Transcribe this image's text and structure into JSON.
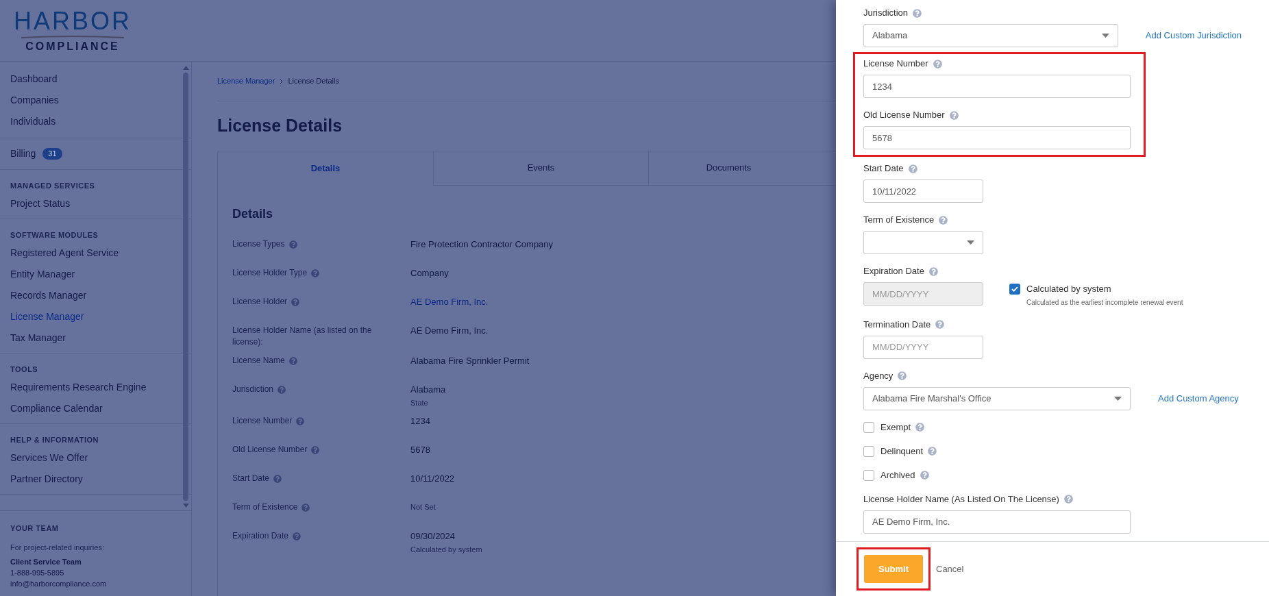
{
  "logo": {
    "name": "HARBOR",
    "tagline": "COMPLIANCE"
  },
  "sidebar": {
    "sections": [
      {
        "items": [
          {
            "label": "Dashboard",
            "selected": false
          },
          {
            "label": "Companies",
            "selected": false
          },
          {
            "label": "Individuals",
            "selected": false
          }
        ]
      },
      {
        "items": [
          {
            "label": "Billing",
            "selected": false,
            "badge": "31"
          }
        ]
      },
      {
        "heading": "MANAGED SERVICES",
        "items": [
          {
            "label": "Project Status",
            "selected": false
          }
        ]
      },
      {
        "heading": "SOFTWARE MODULES",
        "items": [
          {
            "label": "Registered Agent Service",
            "selected": false
          },
          {
            "label": "Entity Manager",
            "selected": false
          },
          {
            "label": "Records Manager",
            "selected": false
          },
          {
            "label": "License Manager",
            "selected": true
          },
          {
            "label": "Tax Manager",
            "selected": false
          }
        ]
      },
      {
        "heading": "TOOLS",
        "items": [
          {
            "label": "Requirements Research Engine",
            "selected": false
          },
          {
            "label": "Compliance Calendar",
            "selected": false
          }
        ]
      },
      {
        "heading": "HELP & INFORMATION",
        "items": [
          {
            "label": "Services We Offer",
            "selected": false
          },
          {
            "label": "Partner Directory",
            "selected": false
          }
        ]
      }
    ],
    "team": {
      "heading": "YOUR TEAM",
      "note": "For project-related inquiries:",
      "name": "Client Service Team",
      "phone": "1-888-995-5895",
      "email": "info@harborcompliance.com"
    }
  },
  "breadcrumb": [
    {
      "label": "License Manager",
      "kind": "link"
    },
    {
      "label": "License Details",
      "kind": "current"
    }
  ],
  "page_title": "License Details",
  "tabs": [
    {
      "label": "Details",
      "selected": true
    },
    {
      "label": "Events",
      "selected": false
    },
    {
      "label": "Documents",
      "selected": false
    }
  ],
  "details": {
    "heading": "Details",
    "rows": [
      {
        "label": "License Types",
        "help": true,
        "value": "Fire Protection Contractor Company",
        "kind": "text"
      },
      {
        "label": "License Holder Type",
        "help": true,
        "value": "Company",
        "kind": "text"
      },
      {
        "label": "License Holder",
        "help": true,
        "value": "AE Demo Firm, Inc.",
        "kind": "link"
      },
      {
        "label": "License Holder Name (as listed on the license):",
        "help": false,
        "value": "AE Demo Firm, Inc.",
        "kind": "text"
      },
      {
        "label": "License Name",
        "help": true,
        "value": "Alabama Fire Sprinkler Permit",
        "kind": "text"
      },
      {
        "label": "Jurisdiction",
        "help": true,
        "value": "Alabama",
        "kind": "text",
        "note": "State"
      },
      {
        "label": "License Number",
        "help": true,
        "value": "1234",
        "kind": "text"
      },
      {
        "label": "Old License Number",
        "help": true,
        "value": "5678",
        "kind": "text"
      },
      {
        "label": "Start Date",
        "help": true,
        "value": "10/11/2022",
        "kind": "text"
      },
      {
        "label": "Term of Existence",
        "help": true,
        "value": "Not Set",
        "kind": "muted"
      },
      {
        "label": "Expiration Date",
        "help": true,
        "value": "09/30/2024",
        "kind": "text",
        "note": "Calculated by system"
      }
    ]
  },
  "form": {
    "fields": [
      {
        "kind": "select",
        "label": "Jurisdiction",
        "value": "Alabama",
        "side_link": "Add Custom Jurisdiction",
        "highlighted": false
      },
      {
        "kind": "text",
        "label": "License Number",
        "value": "1234",
        "highlighted": true
      },
      {
        "kind": "text",
        "label": "Old License Number",
        "value": "5678",
        "highlighted": true
      },
      {
        "kind": "date",
        "label": "Start Date",
        "value": "10/11/2022",
        "highlighted": false
      },
      {
        "kind": "short-select",
        "label": "Term of Existence",
        "highlighted": false
      },
      {
        "kind": "date",
        "label": "Expiration Date",
        "placeholder": "MM/DD/YYYY",
        "disabled": true,
        "highlighted": false,
        "auto": {
          "label": "Calculated by system",
          "checked": true,
          "note": "Calculated as the earliest incomplete renewal event"
        }
      },
      {
        "kind": "date",
        "label": "Termination Date",
        "placeholder": "MM/DD/YYYY",
        "disabled": false,
        "highlighted": false
      },
      {
        "kind": "select",
        "label": "Agency",
        "value": "Alabama Fire Marshal's Office",
        "side_link": "Add Custom Agency",
        "highlighted": false
      },
      {
        "kind": "checkbox",
        "label": "Exempt",
        "checked": false,
        "highlighted": false
      },
      {
        "kind": "checkbox",
        "label": "Delinquent",
        "checked": false,
        "highlighted": false
      },
      {
        "kind": "checkbox",
        "label": "Archived",
        "checked": false,
        "highlighted": false
      },
      {
        "kind": "text",
        "label": "License Holder Name (As Listed On The License)",
        "value": "AE Demo Firm, Inc.",
        "highlighted": false
      }
    ],
    "submit": {
      "label": "Submit",
      "highlighted": true
    },
    "cancel": "Cancel"
  }
}
